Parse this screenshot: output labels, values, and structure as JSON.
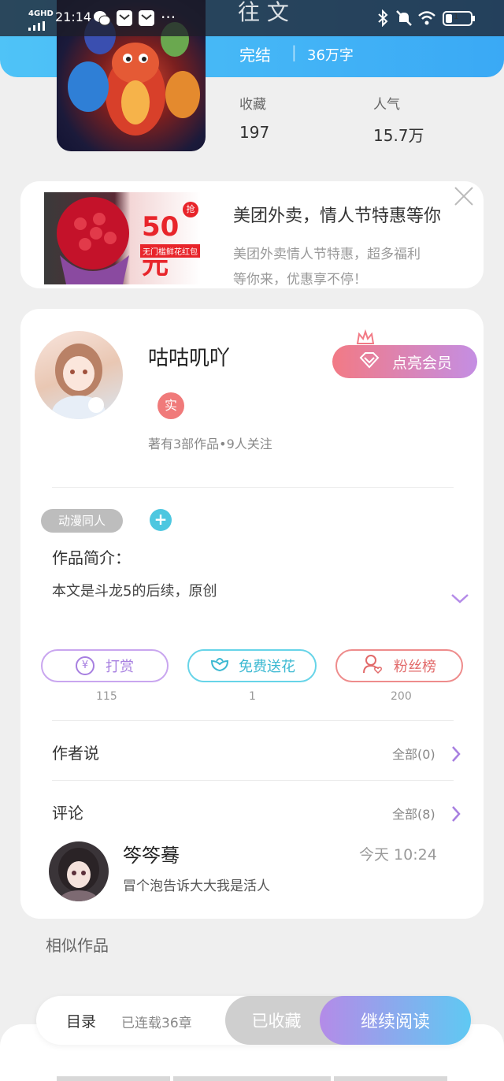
{
  "status_bar": {
    "network": "4GHD",
    "time": "21:14",
    "battery": "1"
  },
  "book": {
    "title_partial": "往 文",
    "status": "完结",
    "word_count": "36万字",
    "favorites_label": "收藏",
    "favorites_value": "197",
    "popularity_label": "人气",
    "popularity_value": "15.7万"
  },
  "ad": {
    "title": "美团外卖，情人节特惠等你",
    "desc_line1": "美团外卖情人节特惠，超多福利",
    "desc_line2": "等你来，优惠享不停！",
    "img_badge_big": "50元",
    "img_badge_small": "抢",
    "img_caption": "无门槛鲜花红包"
  },
  "author": {
    "name": "咕咕叽吖",
    "badge": "实",
    "stats": "著有3部作品•9人关注",
    "vip_button": "点亮会员"
  },
  "tags": {
    "tag1": "动漫同人",
    "add": "+"
  },
  "intro": {
    "heading": "作品简介：",
    "text": "本文是斗龙5的后续，原创"
  },
  "actions": {
    "reward_label": "打赏",
    "reward_count": "115",
    "flower_label": "免费送花",
    "flower_count": "1",
    "fans_label": "粉丝榜",
    "fans_count": "200"
  },
  "author_says": {
    "label": "作者说",
    "all": "全部(0)"
  },
  "comments": {
    "label": "评论",
    "all": "全部(8)",
    "user": "笒笒蓦",
    "time": "今天 10:24",
    "text": "冒个泡告诉大大我是活人"
  },
  "similar": {
    "label": "相似作品"
  },
  "bottom_bar": {
    "toc": "目录",
    "serial": "已连载36章",
    "collected": "已收藏",
    "continue": "继续阅读"
  },
  "colors": {
    "accent_blue": "#3aa9f5",
    "purple": "#b48be8",
    "cyan": "#4dc7e0",
    "coral": "#ee7c7c",
    "vip_gradient_start": "#f27a85",
    "vip_gradient_end": "#c48ee3"
  },
  "icons": {
    "bluetooth": "bluetooth-icon",
    "mute": "bell-off-icon",
    "wifi": "wifi-icon",
    "battery": "battery-icon",
    "close": "close-icon",
    "diamond": "diamond-icon",
    "crown": "crown-icon",
    "yen": "yen-icon",
    "flower": "flower-icon",
    "fans": "user-heart-icon",
    "chevron": "chevron-right-icon",
    "expand": "chevron-down-icon"
  }
}
